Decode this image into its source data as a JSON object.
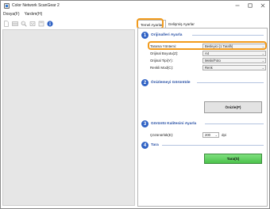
{
  "window": {
    "title": "Color Network ScanGear 2"
  },
  "menu": {
    "file": "Dosya(F)",
    "help": "Yardım(H)"
  },
  "toolbar": {
    "icons": [
      "new-page-icon",
      "scan-icon",
      "zoom-icon",
      "rotate-icon",
      "save-icon",
      "info-icon"
    ]
  },
  "tabs": {
    "basic": "Temel Ayarlar",
    "advanced": "Gelişmiş Ayarlar"
  },
  "sections": {
    "s1": {
      "number": "1",
      "title": "Orijinalleri Ayarla"
    },
    "s2": {
      "number": "2",
      "title": "Önizlemeyi Görüntüle"
    },
    "s3": {
      "number": "3",
      "title": "Görüntü Kalitesini Ayarla"
    },
    "s4": {
      "number": "4",
      "title": "Tara"
    }
  },
  "fields": {
    "scan_mode": {
      "label": "Tarama Yöntemi:",
      "value": "Besleyici (1 Taraflı)"
    },
    "original_size": {
      "label": "Orijinal Boyutu(Z):",
      "value": "A4"
    },
    "original_type": {
      "label": "Orijinal Tipi(Y):",
      "value": "Metin/Foto"
    },
    "color_mode": {
      "label": "Renkli Mod(C):",
      "value": "Renk"
    }
  },
  "preview_button": "Önizle(P)",
  "resolution": {
    "label": "Çözünürlük(E):",
    "value": "200",
    "unit": "dpi"
  },
  "scan_button": "Tara(S)",
  "colors": {
    "accent": "#2f62c4",
    "highlight": "#f29b1c",
    "scan_green": "#4cc24c"
  }
}
